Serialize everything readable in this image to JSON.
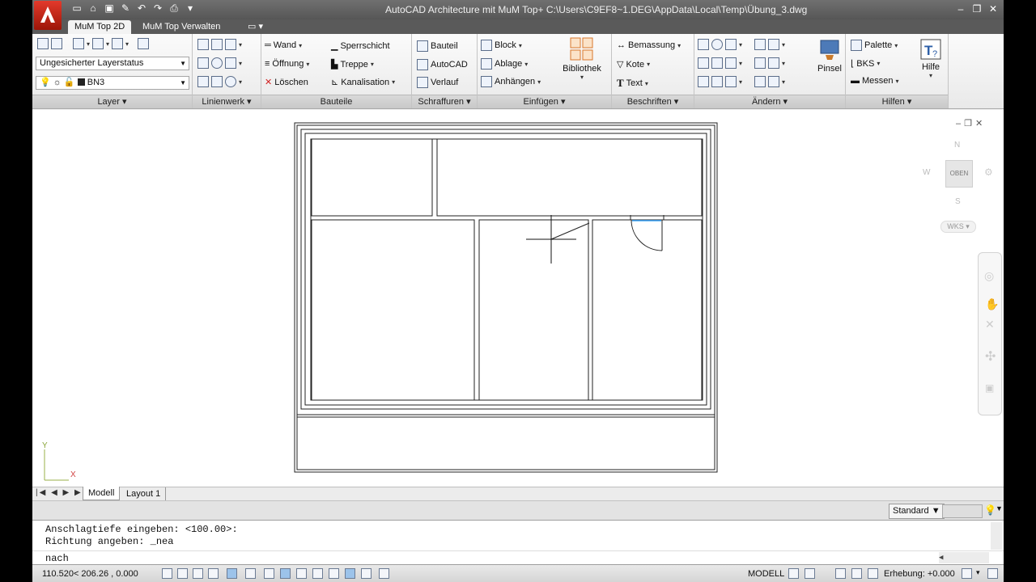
{
  "window": {
    "title": "AutoCAD Architecture mit MuM Top+    C:\\Users\\C9EF8~1.DEG\\AppData\\Local\\Temp\\Übung_3.dwg"
  },
  "tabs": [
    {
      "label": "MuM Top 2D",
      "active": true
    },
    {
      "label": "MuM Top Verwalten",
      "active": false
    }
  ],
  "ribbon": {
    "layer": {
      "title": "Layer",
      "status_combo": "Ungesicherter Layerstatus",
      "current_layer": "BN3"
    },
    "linienwerk": {
      "title": "Linienwerk"
    },
    "bauteile": {
      "title": "Bauteile",
      "wand": "Wand",
      "oeffnung": "Öffnung",
      "loeschen": "Löschen",
      "sperrschicht": "Sperrschicht",
      "treppe": "Treppe",
      "kanalisation": "Kanalisation"
    },
    "schraffuren": {
      "title": "Schraffuren",
      "bauteil": "Bauteil",
      "autocad": "AutoCAD",
      "verlauf": "Verlauf"
    },
    "einfuegen": {
      "title": "Einfügen",
      "block": "Block",
      "ablage": "Ablage",
      "anhaengen": "Anhängen",
      "bibliothek": "Bibliothek"
    },
    "beschriften": {
      "title": "Beschriften",
      "bemassung": "Bemassung",
      "kote": "Kote",
      "text": "Text"
    },
    "aendern": {
      "title": "Ändern",
      "pinsel": "Pinsel"
    },
    "hilfen": {
      "title": "Hilfen",
      "palette": "Palette",
      "bks": "BKS",
      "messen": "Messen",
      "hilfe": "Hilfe"
    }
  },
  "viewcube": {
    "top": "OBEN",
    "north": "N",
    "south": "S",
    "west": "W",
    "wcs": "WKS"
  },
  "ucs": {
    "x": "X",
    "y": "Y"
  },
  "layout_tabs": [
    "Modell",
    "Layout 1"
  ],
  "statusline": {
    "style": "Standard"
  },
  "command": {
    "history": [
      "Anschlagtiefe eingeben: <100.00>:",
      "Richtung angeben: _nea"
    ],
    "current": "nach"
  },
  "statusbar": {
    "coords": "110.520< 206.26 , 0.000",
    "mode": "MODELL",
    "elevation": "Erhebung: +0.000"
  },
  "colors": {
    "accent_blue": "#3ea8ff",
    "logo_red": "#d92b1f"
  }
}
